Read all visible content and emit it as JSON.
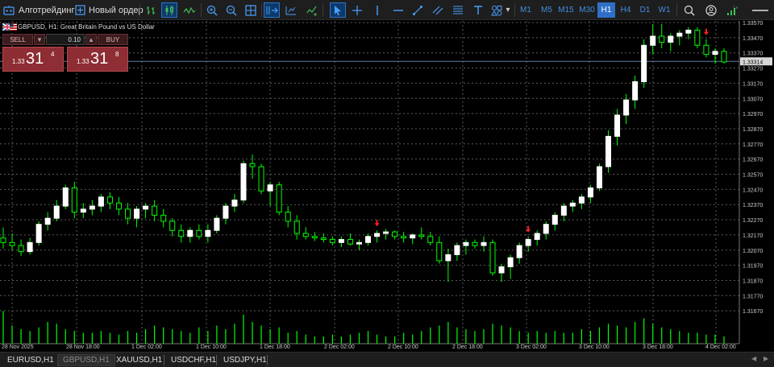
{
  "toolbar": {
    "algo_label": "Алготрейдинг",
    "new_order_label": "Новый ордер",
    "timeframes": [
      "M1",
      "M5",
      "M15",
      "M30",
      "H1",
      "H4",
      "D1",
      "W1"
    ],
    "active_timeframe": "H1",
    "dropdown_arrow": "▾"
  },
  "chart": {
    "symbol_title": "GBPUSD, H1:  Great Britain Pound vs US Dollar",
    "current_price": "1.33314",
    "price_labels": [
      "1.33570",
      "1.33470",
      "1.33370",
      "1.33270",
      "1.33170",
      "1.33070",
      "1.32970",
      "1.32870",
      "1.32770",
      "1.32670",
      "1.32570",
      "1.32470",
      "1.32370",
      "1.32270",
      "1.32170",
      "1.32070",
      "1.31970",
      "1.31870",
      "1.31770",
      "1.31670"
    ],
    "time_labels": [
      "28 Nov 2025",
      "28 Nov 18:00",
      "1 Dec 02:00",
      "1 Dec 10:00",
      "1 Dec 18:00",
      "2 Dec 02:00",
      "2 Dec 10:00",
      "2 Dec 18:00",
      "3 Dec 02:00",
      "3 Dec 10:00",
      "3 Dec 18:00",
      "4 Dec 02:00"
    ],
    "colors": {
      "bull": "#ffffff",
      "bear": "#00ff00",
      "wick": "#00ff00",
      "grid": "#5a5a5a",
      "axis_text": "#cccccc",
      "volume": "#00ff00",
      "price_line": "#5f7aa6"
    }
  },
  "trade_panel": {
    "sell_label": "SELL",
    "buy_label": "BUY",
    "volume": "0.10",
    "sell_prefix": "1.33",
    "sell_big": "31",
    "sell_sup": "4",
    "buy_prefix": "1.33",
    "buy_big": "31",
    "buy_sup": "8"
  },
  "tabs": [
    "EURUSD,H1",
    "GBPUSD,H1",
    "XAUUSD,H1",
    "USDCHF,H1",
    "USDJPY,H1"
  ],
  "active_tab": "GBPUSD,H1",
  "chart_data": {
    "type": "candlestick",
    "symbol": "GBPUSD",
    "timeframe": "H1",
    "ohlc": [
      [
        1.3215,
        1.3222,
        1.3208,
        1.3212
      ],
      [
        1.3212,
        1.3218,
        1.3207,
        1.321
      ],
      [
        1.321,
        1.3214,
        1.3203,
        1.3206
      ],
      [
        1.3206,
        1.3215,
        1.3204,
        1.3212
      ],
      [
        1.3212,
        1.3226,
        1.321,
        1.3224
      ],
      [
        1.3224,
        1.3232,
        1.322,
        1.3228
      ],
      [
        1.3228,
        1.324,
        1.3226,
        1.3236
      ],
      [
        1.3236,
        1.325,
        1.3234,
        1.3248
      ],
      [
        1.3248,
        1.3252,
        1.3228,
        1.3232
      ],
      [
        1.3232,
        1.3238,
        1.3228,
        1.3234
      ],
      [
        1.3234,
        1.324,
        1.323,
        1.3236
      ],
      [
        1.3236,
        1.3244,
        1.3232,
        1.3242
      ],
      [
        1.3242,
        1.3245,
        1.3234,
        1.3238
      ],
      [
        1.3238,
        1.3242,
        1.323,
        1.3234
      ],
      [
        1.3234,
        1.3238,
        1.3224,
        1.3228
      ],
      [
        1.3228,
        1.3236,
        1.3222,
        1.3234
      ],
      [
        1.3234,
        1.3238,
        1.3228,
        1.3236
      ],
      [
        1.3236,
        1.324,
        1.3226,
        1.323
      ],
      [
        1.323,
        1.3234,
        1.3222,
        1.3226
      ],
      [
        1.3226,
        1.3228,
        1.3216,
        1.322
      ],
      [
        1.322,
        1.3224,
        1.3212,
        1.3216
      ],
      [
        1.3216,
        1.3222,
        1.3212,
        1.322
      ],
      [
        1.322,
        1.3224,
        1.3214,
        1.3216
      ],
      [
        1.3216,
        1.3224,
        1.3212,
        1.322
      ],
      [
        1.322,
        1.323,
        1.3218,
        1.3228
      ],
      [
        1.3228,
        1.3238,
        1.3224,
        1.3236
      ],
      [
        1.3236,
        1.3244,
        1.3232,
        1.324
      ],
      [
        1.324,
        1.3266,
        1.3238,
        1.3264
      ],
      [
        1.3264,
        1.327,
        1.3254,
        1.3262
      ],
      [
        1.3262,
        1.3264,
        1.3244,
        1.3246
      ],
      [
        1.3246,
        1.3252,
        1.3236,
        1.325
      ],
      [
        1.325,
        1.3252,
        1.323,
        1.3232
      ],
      [
        1.3232,
        1.3236,
        1.3222,
        1.3226
      ],
      [
        1.3226,
        1.323,
        1.3214,
        1.3218
      ],
      [
        1.3218,
        1.3222,
        1.3214,
        1.3216
      ],
      [
        1.3216,
        1.3219,
        1.3213,
        1.3215
      ],
      [
        1.3215,
        1.3218,
        1.3212,
        1.3214
      ],
      [
        1.3214,
        1.3216,
        1.321,
        1.3212
      ],
      [
        1.3212,
        1.3216,
        1.3209,
        1.3214
      ],
      [
        1.3214,
        1.3218,
        1.321,
        1.3211
      ],
      [
        1.3211,
        1.3214,
        1.3207,
        1.3212
      ],
      [
        1.3212,
        1.3218,
        1.321,
        1.3216
      ],
      [
        1.3216,
        1.322,
        1.3212,
        1.3218
      ],
      [
        1.3218,
        1.3221,
        1.3214,
        1.3219
      ],
      [
        1.3219,
        1.322,
        1.3214,
        1.3216
      ],
      [
        1.3216,
        1.3219,
        1.3212,
        1.3215
      ],
      [
        1.3215,
        1.3218,
        1.3211,
        1.3217
      ],
      [
        1.3217,
        1.3222,
        1.3214,
        1.3216
      ],
      [
        1.3216,
        1.3219,
        1.321,
        1.3212
      ],
      [
        1.3212,
        1.3216,
        1.3198,
        1.32
      ],
      [
        1.32,
        1.3208,
        1.3186,
        1.3204
      ],
      [
        1.3204,
        1.3212,
        1.32,
        1.321
      ],
      [
        1.321,
        1.3214,
        1.3204,
        1.3212
      ],
      [
        1.3212,
        1.3214,
        1.3208,
        1.321
      ],
      [
        1.321,
        1.3216,
        1.3206,
        1.3212
      ],
      [
        1.3212,
        1.3214,
        1.319,
        1.3192
      ],
      [
        1.3192,
        1.3198,
        1.3186,
        1.3196
      ],
      [
        1.3196,
        1.3204,
        1.3188,
        1.3202
      ],
      [
        1.3202,
        1.3212,
        1.3198,
        1.321
      ],
      [
        1.321,
        1.3216,
        1.3206,
        1.3214
      ],
      [
        1.3214,
        1.322,
        1.321,
        1.3218
      ],
      [
        1.3218,
        1.3226,
        1.3214,
        1.3224
      ],
      [
        1.3224,
        1.3232,
        1.322,
        1.323
      ],
      [
        1.323,
        1.3238,
        1.3226,
        1.3236
      ],
      [
        1.3236,
        1.324,
        1.3232,
        1.3238
      ],
      [
        1.3238,
        1.3244,
        1.3234,
        1.3242
      ],
      [
        1.3242,
        1.325,
        1.3238,
        1.3248
      ],
      [
        1.3248,
        1.3264,
        1.3246,
        1.3262
      ],
      [
        1.3262,
        1.3286,
        1.3258,
        1.3282
      ],
      [
        1.3282,
        1.33,
        1.3276,
        1.3296
      ],
      [
        1.3296,
        1.331,
        1.329,
        1.3306
      ],
      [
        1.3306,
        1.3322,
        1.33,
        1.3318
      ],
      [
        1.3318,
        1.3346,
        1.3314,
        1.3342
      ],
      [
        1.3342,
        1.3356,
        1.3336,
        1.3348
      ],
      [
        1.3348,
        1.3356,
        1.334,
        1.3344
      ],
      [
        1.3344,
        1.335,
        1.3338,
        1.3348
      ],
      [
        1.3348,
        1.3352,
        1.3342,
        1.335
      ],
      [
        1.335,
        1.3354,
        1.3346,
        1.3352
      ],
      [
        1.3352,
        1.3354,
        1.334,
        1.3342
      ],
      [
        1.3342,
        1.3346,
        1.3334,
        1.3336
      ],
      [
        1.3336,
        1.334,
        1.333,
        1.3338
      ],
      [
        1.3338,
        1.334,
        1.333,
        1.3331
      ]
    ],
    "volume_relative": [
      0.9,
      0.5,
      0.4,
      0.35,
      0.45,
      0.6,
      0.55,
      0.4,
      0.35,
      0.3,
      0.3,
      0.35,
      0.3,
      0.25,
      0.35,
      0.3,
      0.4,
      0.5,
      0.45,
      0.4,
      0.35,
      0.3,
      0.45,
      0.35,
      0.5,
      0.4,
      0.55,
      0.8,
      0.6,
      0.5,
      0.4,
      0.45,
      0.3,
      0.35,
      0.25,
      0.2,
      0.2,
      0.25,
      0.2,
      0.25,
      0.3,
      0.35,
      0.25,
      0.2,
      0.2,
      0.3,
      0.25,
      0.35,
      0.45,
      0.5,
      0.6,
      0.45,
      0.4,
      0.35,
      0.4,
      0.55,
      0.5,
      0.45,
      0.35,
      0.3,
      0.35,
      0.3,
      0.35,
      0.3,
      0.3,
      0.4,
      0.35,
      0.45,
      0.55,
      0.5,
      0.45,
      0.6,
      0.7,
      0.55,
      0.45,
      0.4,
      0.35,
      0.3,
      0.3,
      0.25,
      0.25,
      0.2
    ],
    "markers": [
      {
        "index": 42,
        "type": "arrow-down-red"
      },
      {
        "index": 59,
        "type": "arrow-down-red"
      },
      {
        "index": 79,
        "type": "arrow-down-red"
      }
    ]
  }
}
